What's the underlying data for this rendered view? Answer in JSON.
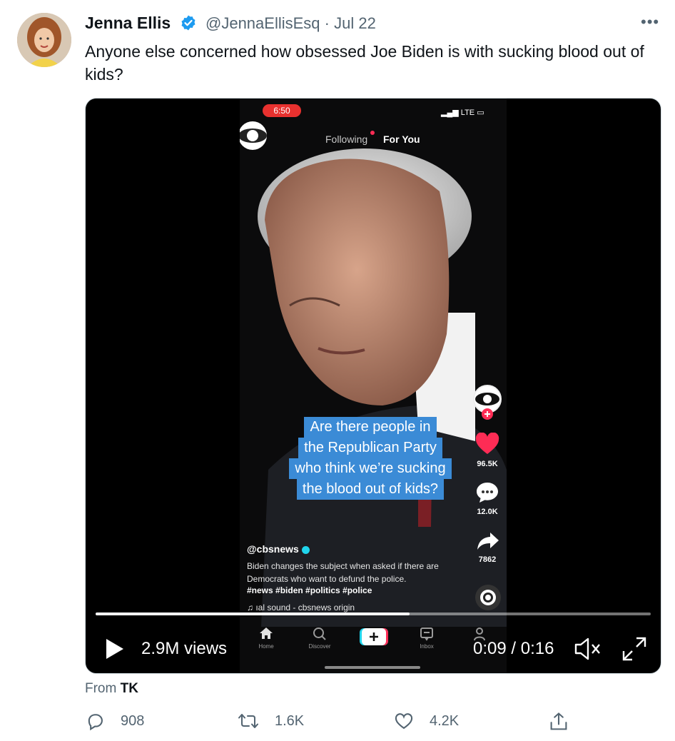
{
  "tweet": {
    "author_name": "Jenna Ellis",
    "handle": "@JennaEllisEsq",
    "separator": "·",
    "date": "Jul 22",
    "more_label": "•••",
    "text": "Anyone else concerned how obsessed Joe Biden is with sucking blood out of kids?",
    "source_prefix": "From",
    "source_name": "TK"
  },
  "video": {
    "views": "2.9M views",
    "time_current": "0:09",
    "time_separator": "/",
    "time_total": "0:16",
    "progress_fraction": 0.565,
    "overlay": {
      "status_time": "6:50",
      "network": "LTE",
      "tab_following": "Following",
      "tab_for_you": "For You",
      "caption_lines": [
        "Are there people in",
        "the Republican Party",
        "who think we’re sucking",
        "the blood out of kids?"
      ],
      "likes": "96.5K",
      "comments": "12.0K",
      "shares": "7862",
      "username": "@cbsnews",
      "description": "Biden changes the subject when asked if there are Democrats who want to defund the police.",
      "hashtags": "#news #biden #politics #police",
      "sound": "ıal sound - cbsnews    origin",
      "nav": [
        "Home",
        "Discover",
        "",
        "Inbox",
        ""
      ]
    }
  },
  "actions": {
    "replies": "908",
    "retweets": "1.6K",
    "likes": "4.2K"
  },
  "colors": {
    "verified": "#1d9bf0",
    "text_secondary": "#536471",
    "caption_bg": "#3b8bd6",
    "like_red": "#fe2c55"
  },
  "icons": [
    "verified-icon",
    "more-icon",
    "play-icon",
    "mute-icon",
    "fullscreen-icon",
    "reply-icon",
    "retweet-icon",
    "like-icon",
    "share-icon",
    "cbs-logo-icon",
    "heart-icon",
    "comment-icon",
    "share-arrow-icon",
    "music-icon",
    "home-icon",
    "discover-icon",
    "create-icon",
    "inbox-icon",
    "profile-icon"
  ]
}
